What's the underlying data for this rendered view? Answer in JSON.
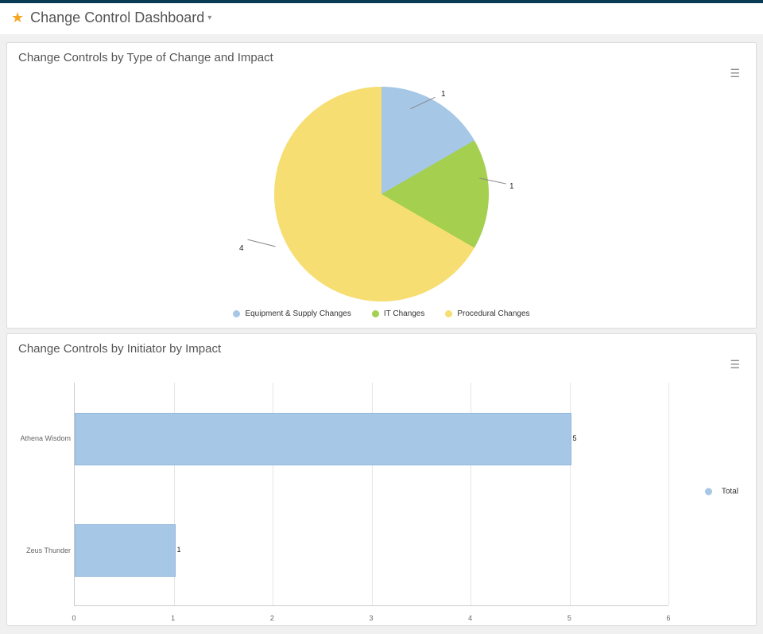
{
  "header": {
    "title": "Change Control Dashboard"
  },
  "panel1": {
    "title": "Change Controls by Type of Change and Impact",
    "legend": {
      "a": "Equipment & Supply Changes",
      "b": "IT Changes",
      "c": "Procedural Changes"
    },
    "labels": {
      "a": "1",
      "b": "1",
      "c": "4"
    }
  },
  "panel2": {
    "title": "Change Controls by Initiator by Impact",
    "legend": "Total",
    "y": {
      "a": "Athena Wisdom",
      "b": "Zeus Thunder"
    },
    "val": {
      "a": "5",
      "b": "1"
    },
    "x": {
      "t0": "0",
      "t1": "1",
      "t2": "2",
      "t3": "3",
      "t4": "4",
      "t5": "5",
      "t6": "6"
    }
  },
  "colors": {
    "blue": "#a6c7e6",
    "green": "#a4cf4f",
    "yellow": "#f6de72"
  },
  "chart_data": [
    {
      "type": "pie",
      "title": "Change Controls by Type of Change and Impact",
      "series": [
        {
          "name": "Equipment & Supply Changes",
          "value": 1,
          "color": "#a6c7e6"
        },
        {
          "name": "IT Changes",
          "value": 1,
          "color": "#a4cf4f"
        },
        {
          "name": "Procedural Changes",
          "value": 4,
          "color": "#f6de72"
        }
      ],
      "legend_position": "bottom"
    },
    {
      "type": "bar",
      "orientation": "horizontal",
      "title": "Change Controls by Initiator by Impact",
      "categories": [
        "Athena Wisdom",
        "Zeus Thunder"
      ],
      "series": [
        {
          "name": "Total",
          "values": [
            5,
            1
          ],
          "color": "#a6c7e6"
        }
      ],
      "xlabel": "",
      "ylabel": "",
      "xlim": [
        0,
        6
      ],
      "grid": true,
      "legend_position": "right"
    }
  ]
}
